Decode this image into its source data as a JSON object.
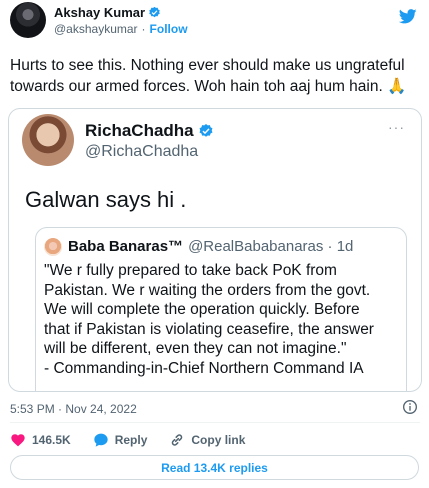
{
  "author": {
    "name": "Akshay Kumar",
    "handle": "@akshaykumar",
    "separator": "·",
    "follow_label": "Follow"
  },
  "tweet": {
    "text": "Hurts to see this. Nothing ever should make us ungrateful towards our armed forces. Woh hain toh aaj hum hain. 🙏"
  },
  "quoted": {
    "name": "RichaChadha",
    "handle": "@RichaChadha",
    "more": "···",
    "text": "Galwan says hi ."
  },
  "inner_quote": {
    "name": "Baba Banaras™",
    "handle": "@RealBababanaras · 1d",
    "lines": [
      "\"We r fully prepared to take back PoK from",
      "Pakistan. We r waiting the orders from the govt.",
      "We will complete the operation quickly. Before",
      "that if Pakistan is violating ceasefire, the answer",
      "will be different, even they can not imagine.\"",
      "- Commanding-in-Chief Northern Command IA"
    ]
  },
  "meta": {
    "timestamp": "5:53 PM · Nov 24, 2022"
  },
  "actions": {
    "likes": "146.5K",
    "reply_label": "Reply",
    "copy_link_label": "Copy link"
  },
  "replies_button": "Read 13.4K replies",
  "colors": {
    "accent": "#1d9bf0",
    "like": "#f91880",
    "text": "#0f1419",
    "secondary": "#536471",
    "border": "#cfd9de"
  },
  "icons": [
    "verified-badge-icon",
    "twitter-bird-icon",
    "more-icon",
    "info-icon",
    "heart-icon",
    "reply-icon",
    "link-icon"
  ]
}
